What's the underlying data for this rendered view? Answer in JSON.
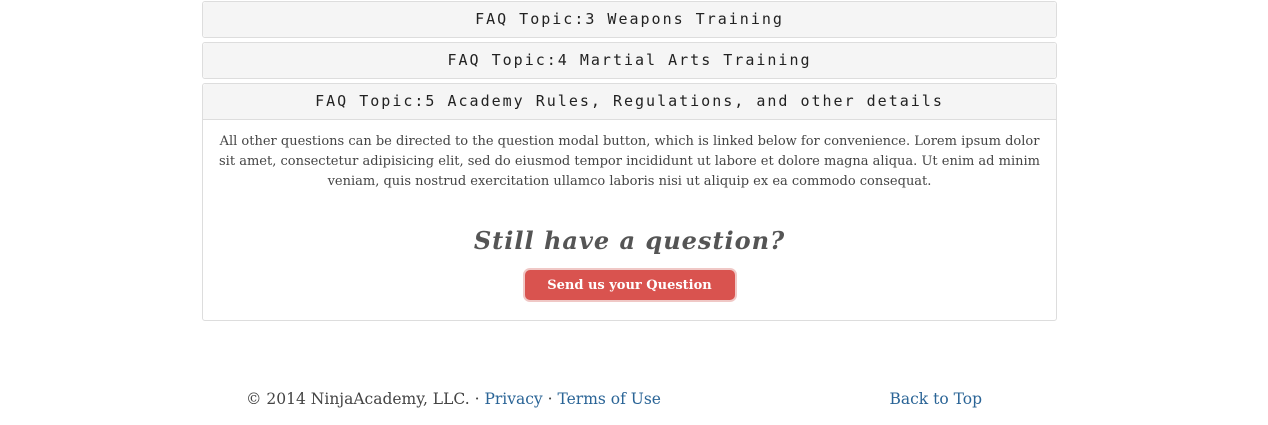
{
  "faq": {
    "topics": [
      {
        "title": "FAQ Topic:3 Weapons Training",
        "expanded": false
      },
      {
        "title": "FAQ Topic:4 Martial Arts Training",
        "expanded": false
      },
      {
        "title": "FAQ Topic:5 Academy Rules, Regulations, and other details",
        "expanded": true
      }
    ],
    "open_body_text": "All other questions can be directed to the question modal button, which is linked below for convenience. Lorem ipsum dolor sit amet, consectetur adipisicing elit, sed do eiusmod tempor incididunt ut labore et dolore magna aliqua. Ut enim ad minim veniam, quis nostrud exercitation ullamco laboris nisi ut aliquip ex ea commodo consequat.",
    "still_question_heading": "Still have a question?",
    "send_button_label": "Send us your Question"
  },
  "footer": {
    "copyright": "© 2014 NinjaAcademy, LLC.",
    "separator": "·",
    "privacy_label": "Privacy",
    "terms_label": "Terms of Use",
    "back_to_top_label": "Back to Top"
  },
  "colors": {
    "button_bg": "#d9534f",
    "link": "#2a6496",
    "panel_heading_bg": "#f5f5f5"
  }
}
